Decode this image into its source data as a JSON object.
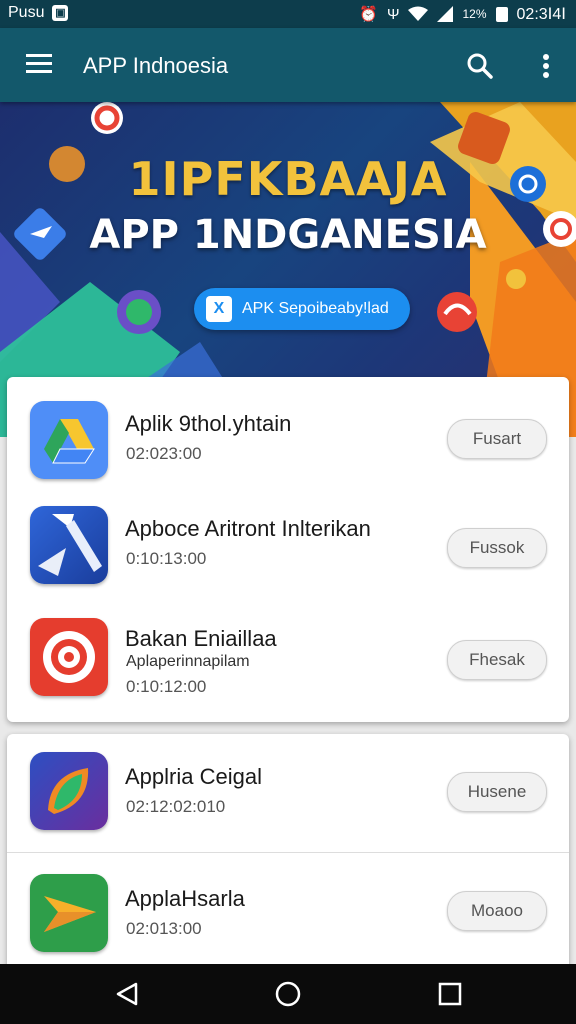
{
  "status_bar": {
    "carrier": "Pusu",
    "signal_text": "12%",
    "time": "02:3Ⅰ4Ⅰ"
  },
  "toolbar": {
    "title": "APP Indnoesia"
  },
  "banner": {
    "line1": "1IPFKBAAJA",
    "line2": "APP 1NDGANESIA",
    "button_label": "APK Sepoibeaby!lad",
    "button_icon": "X"
  },
  "apps": [
    {
      "name": "Aplik 9thol.yhtain",
      "subtitle": "",
      "meta": "02:023:00",
      "button": "Fusart",
      "icon": "drive-icon"
    },
    {
      "name": "Apboce Aritront Inlterikan",
      "subtitle": "",
      "meta": "0:10:13:00",
      "button": "Fussok",
      "icon": "tool-icon"
    },
    {
      "name": "Bakan Eniaillaa",
      "subtitle": "Aplaperinnapilam",
      "meta": "0:10:12:00",
      "button": "Fhesak",
      "icon": "target-icon"
    },
    {
      "name": "Applria Ceigal",
      "subtitle": "",
      "meta": "02:12:02:010",
      "button": "Husene",
      "icon": "leaf-icon"
    },
    {
      "name": "ApplaHsarla",
      "subtitle": "",
      "meta": "02:013:00",
      "button": "Moaoo",
      "icon": "arrow-icon"
    }
  ],
  "colors": {
    "toolbar": "#13586b",
    "status_bar": "#0d3d4c",
    "banner_accent": "#f2c23c",
    "primary_button": "#1c8ef0"
  }
}
